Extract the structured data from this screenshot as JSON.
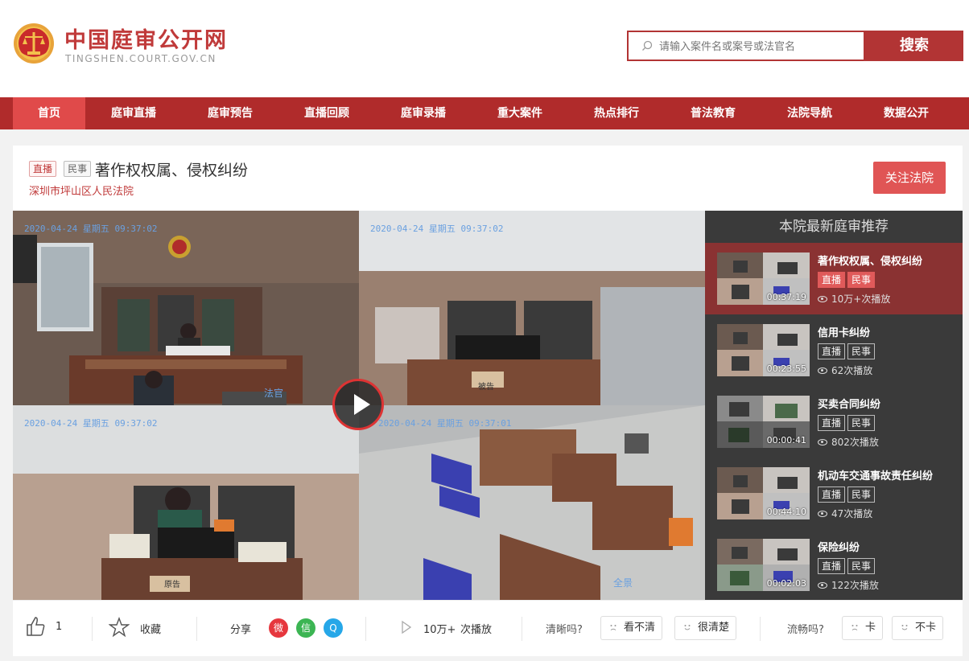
{
  "site": {
    "title": "中国庭审公开网",
    "subtitle": "TINGSHEN.COURT.GOV.CN"
  },
  "search": {
    "placeholder": "请输入案件名或案号或法官名",
    "button_label": "搜索"
  },
  "nav": {
    "items": [
      {
        "label": "首页",
        "active": true
      },
      {
        "label": "庭审直播"
      },
      {
        "label": "庭审预告"
      },
      {
        "label": "直播回顾"
      },
      {
        "label": "庭审录播"
      },
      {
        "label": "重大案件"
      },
      {
        "label": "热点排行"
      },
      {
        "label": "普法教育"
      },
      {
        "label": "法院导航"
      },
      {
        "label": "数据公开"
      }
    ]
  },
  "case": {
    "tag_live": "直播",
    "tag_type": "民事",
    "title": "著作权权属、侵权纠纷",
    "court": "深圳市坪山区人民法院",
    "follow_label": "关注法院"
  },
  "video": {
    "timestamps": [
      "2020-04-24 星期五 09:37:02",
      "2020-04-24 星期五 09:37:02",
      "2020-04-24 星期五 09:37:02",
      "2020-04-24 星期五 09:37:01"
    ],
    "labels": [
      "法官",
      "被告",
      "原告",
      "全景"
    ]
  },
  "sidebar": {
    "title": "本院最新庭审推荐",
    "items": [
      {
        "title": "著作权权属、侵权纠纷",
        "tags": [
          "直播",
          "民事"
        ],
        "duration": "00:37:19",
        "views": "10万+次播放",
        "active": true
      },
      {
        "title": "信用卡纠纷",
        "tags": [
          "直播",
          "民事"
        ],
        "duration": "00:23:55",
        "views": "62次播放"
      },
      {
        "title": "买卖合同纠纷",
        "tags": [
          "直播",
          "民事"
        ],
        "duration": "00:00:41",
        "views": "802次播放"
      },
      {
        "title": "机动车交通事故责任纠纷",
        "tags": [
          "直播",
          "民事"
        ],
        "duration": "00:44:10",
        "views": "47次播放"
      },
      {
        "title": "保险纠纷",
        "tags": [
          "直播",
          "民事"
        ],
        "duration": "00:02:03",
        "views": "122次播放"
      }
    ]
  },
  "actions": {
    "like_count": "1",
    "favorite_label": "收藏",
    "share_label": "分享",
    "play_count": "10万+",
    "play_label": "次播放",
    "clarity_question": "清晰吗?",
    "clarity_bad": "看不清",
    "clarity_good": "很清楚",
    "smooth_question": "流畅吗?",
    "smooth_bad": "卡",
    "smooth_good": "不卡"
  },
  "colors": {
    "brand_red": "#b02b2b",
    "active_nav": "#e04a4a",
    "sidebar_bg": "#3a3a3a",
    "sidebar_active": "#8a3232"
  }
}
